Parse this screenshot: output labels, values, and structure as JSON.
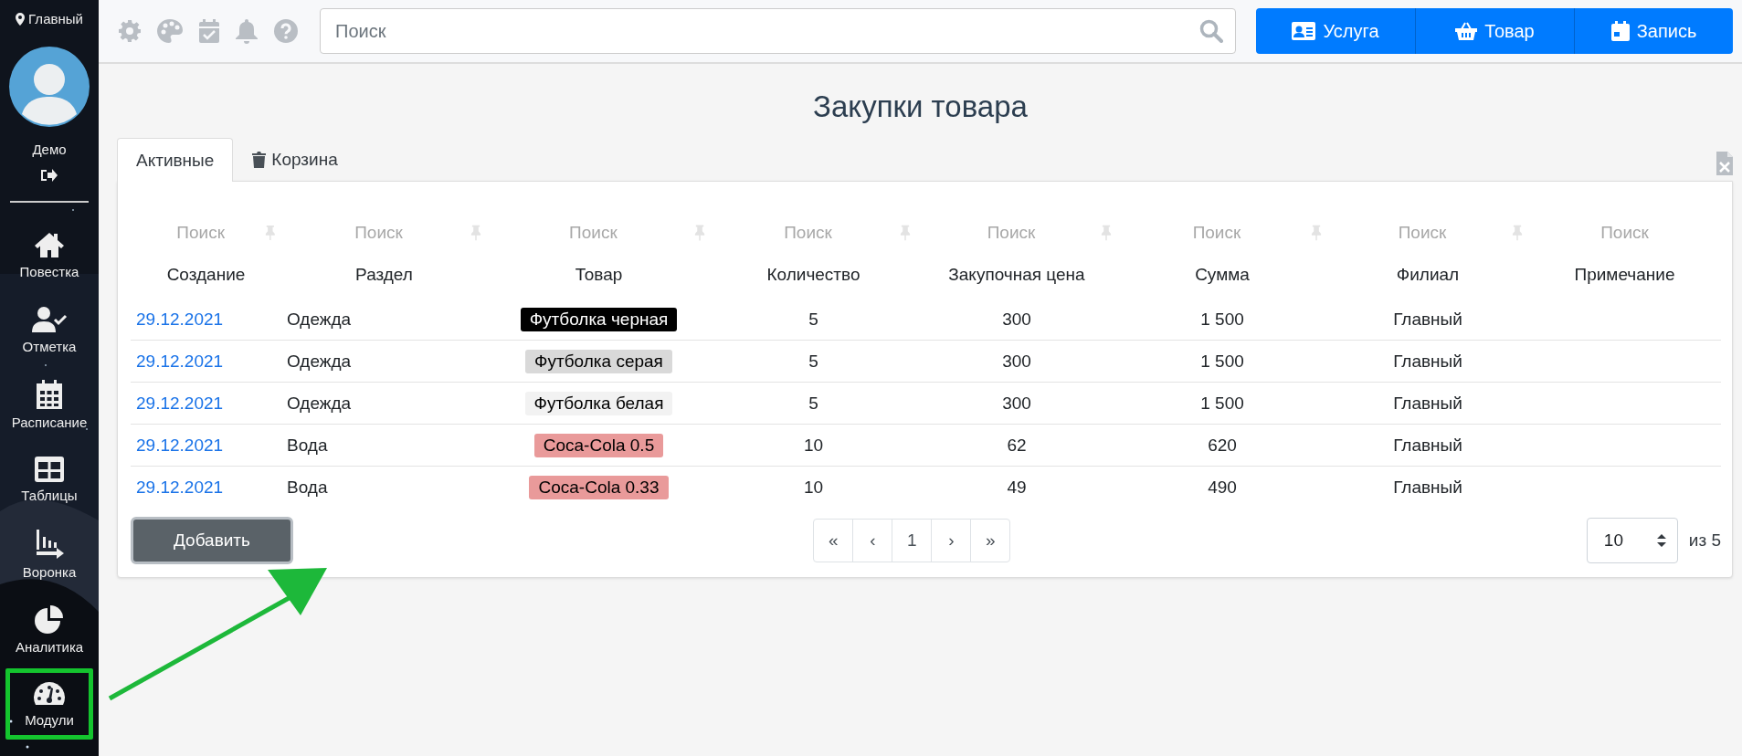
{
  "sidebar": {
    "branch": "Главный",
    "user": "Демо",
    "items": [
      {
        "label": "Повестка",
        "kind": "home",
        "highlighted": false
      },
      {
        "label": "Отметка",
        "kind": "usercheck",
        "highlighted": false
      },
      {
        "label": "Расписание",
        "kind": "calendar",
        "highlighted": false
      },
      {
        "label": "Таблицы",
        "kind": "table",
        "highlighted": false
      },
      {
        "label": "Воронка",
        "kind": "funnel",
        "highlighted": false
      },
      {
        "label": "Аналитика",
        "kind": "pie",
        "highlighted": false
      },
      {
        "label": "Модули",
        "kind": "gauge",
        "highlighted": true
      }
    ]
  },
  "search": {
    "placeholder": "Поиск"
  },
  "actions": [
    {
      "label": "Услуга",
      "kind": "service"
    },
    {
      "label": "Товар",
      "kind": "goods"
    },
    {
      "label": "Запись",
      "kind": "booking"
    }
  ],
  "page": {
    "title": "Закупки товара",
    "tabs": [
      {
        "label": "Активные",
        "selected": true,
        "kind": "plain"
      },
      {
        "label": "Корзина",
        "selected": false,
        "kind": "trash"
      }
    ]
  },
  "table": {
    "filters": [
      {
        "placeholder": "Поиск"
      },
      {
        "placeholder": "Поиск"
      },
      {
        "placeholder": "Поиск"
      },
      {
        "placeholder": "Поиск"
      },
      {
        "placeholder": "Поиск"
      },
      {
        "placeholder": "Поиск"
      },
      {
        "placeholder": "Поиск"
      },
      {
        "placeholder": "Поиск"
      }
    ],
    "columns": [
      "Создание",
      "Раздел",
      "Товар",
      "Количество",
      "Закупочная цена",
      "Сумма",
      "Филиал",
      "Примечание"
    ],
    "rows": [
      {
        "created": "29.12.2021",
        "section": "Одежда",
        "product": {
          "label": "Футболка черная",
          "color": "#000000"
        },
        "quantity": "5",
        "price": "300",
        "sum": "1 500",
        "branch": "Главный"
      },
      {
        "created": "29.12.2021",
        "section": "Одежда",
        "product": {
          "label": "Футболка серая",
          "color": "#d9d9d9"
        },
        "quantity": "5",
        "price": "300",
        "sum": "1 500",
        "branch": "Главный"
      },
      {
        "created": "29.12.2021",
        "section": "Одежда",
        "product": {
          "label": "Футболка белая",
          "color": "#f2f2f2"
        },
        "quantity": "5",
        "price": "300",
        "sum": "1 500",
        "branch": "Главный"
      },
      {
        "created": "29.12.2021",
        "section": "Вода",
        "product": {
          "label": "Coca-Cola 0.5",
          "color": "#e99a9a"
        },
        "quantity": "10",
        "price": "62",
        "sum": "620",
        "branch": "Главный"
      },
      {
        "created": "29.12.2021",
        "section": "Вода",
        "product": {
          "label": "Coca-Cola 0.33",
          "color": "#e99a9a"
        },
        "quantity": "10",
        "price": "49",
        "sum": "490",
        "branch": "Главный"
      }
    ]
  },
  "add_button": "Добавить",
  "pagination": [
    "«",
    "‹",
    "1",
    "›",
    "»"
  ],
  "page_size": {
    "value": "10",
    "total": "из 5"
  },
  "annotation": {
    "arrow": true
  }
}
